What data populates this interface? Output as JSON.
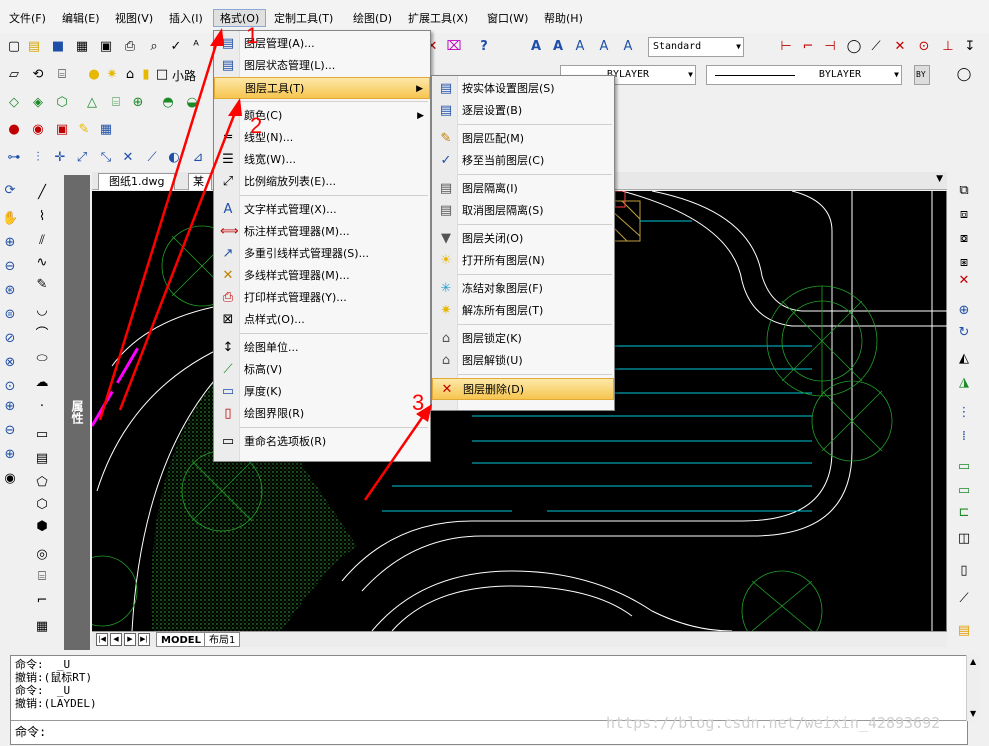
{
  "menubar": [
    "文件(F)",
    "编辑(E)",
    "视图(V)",
    "插入(I)",
    "格式(O)",
    "定制工具(T)",
    "绘图(D)",
    "扩展工具(X)",
    "窗口(W)",
    "帮助(H)"
  ],
  "toolbar": {
    "text_style": "Standard",
    "layer_name": "小路",
    "linetype": "BYLAYER",
    "lineweight": "BYLAYER",
    "bylayer_short": "BY"
  },
  "tabs": {
    "doc": "图纸1.dwg",
    "doc2": "某"
  },
  "layout_tabs": [
    "MODEL",
    "布局1"
  ],
  "side_panel": "属性",
  "format_menu": [
    {
      "label": "图层管理(A)...",
      "icon": "layer-manager-icon"
    },
    {
      "label": "图层状态管理(L)...",
      "icon": "layer-state-icon"
    },
    {
      "label": "图层工具(T)",
      "icon": "",
      "submenu": true
    },
    {
      "sep": true
    },
    {
      "label": "颜色(C)",
      "icon": "",
      "submenu": true
    },
    {
      "label": "线型(N)...",
      "icon": "linetype-icon"
    },
    {
      "label": "线宽(W)...",
      "icon": "lineweight-icon"
    },
    {
      "label": "比例缩放列表(E)...",
      "icon": "scale-list-icon"
    },
    {
      "sep": true
    },
    {
      "label": "文字样式管理(X)...",
      "icon": "text-style-icon"
    },
    {
      "label": "标注样式管理器(M)...",
      "icon": "dim-style-icon"
    },
    {
      "label": "多重引线样式管理器(S)...",
      "icon": "mleader-style-icon"
    },
    {
      "label": "多线样式管理器(M)...",
      "icon": "mline-style-icon"
    },
    {
      "label": "打印样式管理器(Y)...",
      "icon": "plot-style-icon"
    },
    {
      "label": "点样式(O)...",
      "icon": "point-style-icon"
    },
    {
      "sep": true
    },
    {
      "label": "绘图单位...",
      "icon": "units-icon"
    },
    {
      "label": "标高(V)",
      "icon": "elevation-icon"
    },
    {
      "label": "厚度(K)",
      "icon": "thickness-icon"
    },
    {
      "label": "绘图界限(R)",
      "icon": "limits-icon"
    },
    {
      "sep": true
    },
    {
      "label": "重命名选项板(R)",
      "icon": "rename-icon"
    }
  ],
  "layer_tools_menu": [
    {
      "label": "按实体设置图层(S)"
    },
    {
      "label": "逐层设置(B)"
    },
    {
      "sep": true
    },
    {
      "label": "图层匹配(M)"
    },
    {
      "label": "移至当前图层(C)"
    },
    {
      "sep": true
    },
    {
      "label": "图层隔离(I)"
    },
    {
      "label": "取消图层隔离(S)"
    },
    {
      "sep": true
    },
    {
      "label": "图层关闭(O)"
    },
    {
      "label": "打开所有图层(N)"
    },
    {
      "sep": true
    },
    {
      "label": "冻结对象图层(F)"
    },
    {
      "label": "解冻所有图层(T)"
    },
    {
      "sep": true
    },
    {
      "label": "图层锁定(K)"
    },
    {
      "label": "图层解锁(U)"
    },
    {
      "sep": true
    },
    {
      "label": "图层删除(D)"
    }
  ],
  "command_lines": [
    "命令:  _U",
    "撤销:(鼠标RT)",
    "命令:  _U",
    "撤销:(LAYDEL)"
  ],
  "command_prompt": "命令:",
  "watermark": "https://blog.csdn.net/weixin_42893692",
  "annotations": [
    "1",
    "2",
    "3"
  ]
}
